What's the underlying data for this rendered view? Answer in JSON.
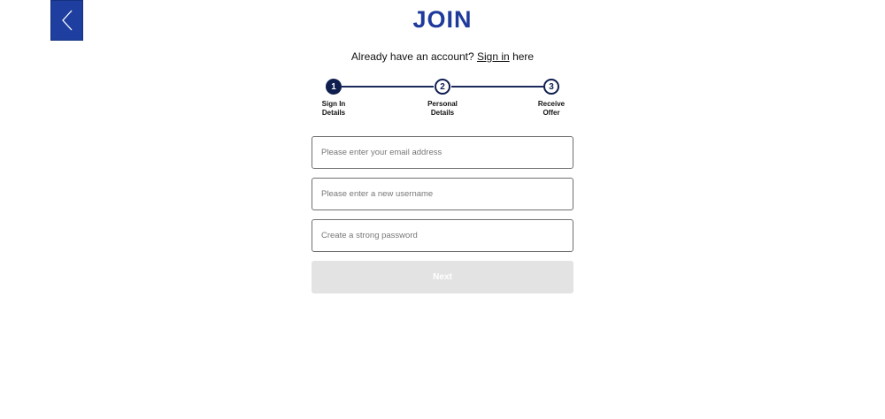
{
  "header": {
    "title": "JOIN",
    "back_icon": "chevron-left-icon"
  },
  "signin": {
    "prefix": "Already have an account?",
    "link_label": "Sign in",
    "suffix": "here"
  },
  "stepper": {
    "current_step": 1,
    "steps": [
      {
        "number": "1",
        "label": "Sign In\nDetails"
      },
      {
        "number": "2",
        "label": "Personal\nDetails"
      },
      {
        "number": "3",
        "label": "Receive\nOffer"
      }
    ]
  },
  "form": {
    "email_placeholder": "Please enter your email address",
    "username_placeholder": "Please enter a new username",
    "password_placeholder": "Create a strong password",
    "email_value": "",
    "username_value": "",
    "password_value": "",
    "next_label": "Next"
  },
  "colors": {
    "brand_blue": "#1e3a9b",
    "stepper_navy": "#0f1e4f",
    "disabled_button": "#e3e3e3"
  }
}
